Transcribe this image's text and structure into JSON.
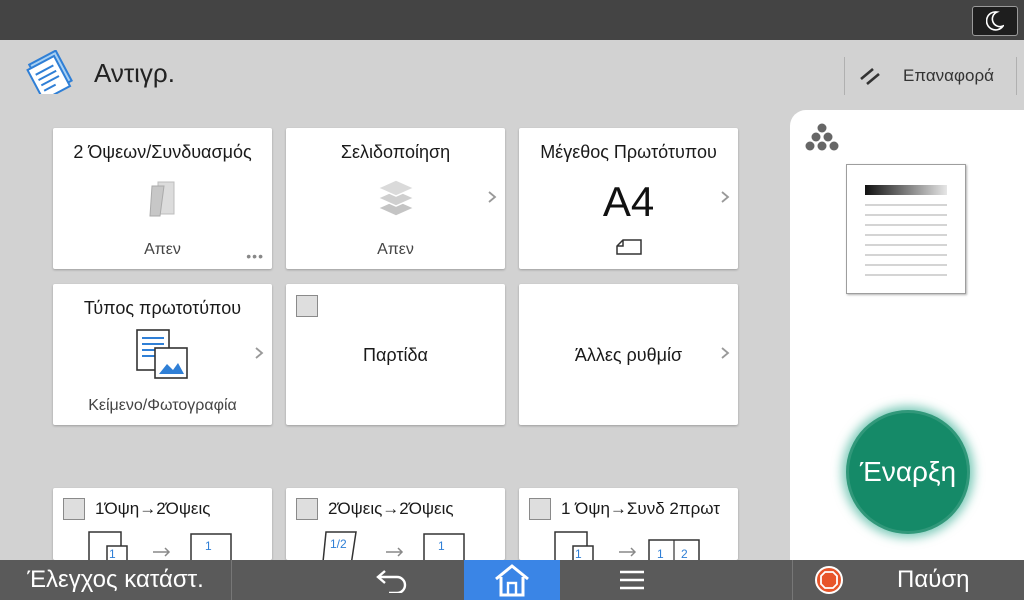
{
  "app": {
    "title": "Αντιγρ.",
    "icon": "copy-document-icon"
  },
  "topbar": {
    "sleep_icon": "moon-icon"
  },
  "reset": {
    "label": "Επαναφορά",
    "icon": "reset-slash-icon"
  },
  "tiles": {
    "duplex": {
      "title": "2 Όψεων/Συνδυασμός",
      "value": "Απεν",
      "icon": "duplex-page-icon"
    },
    "sort": {
      "title": "Σελιδοποίηση",
      "value": "Απεν",
      "icon": "stack-icon"
    },
    "original_size": {
      "title": "Μέγεθος Πρωτότυπου",
      "value": "A4",
      "icon": "paper-orientation-icon"
    },
    "original_type": {
      "title": "Τύπος πρωτοτύπου",
      "value": "Κείμενο/Φωτογραφία",
      "icon": "text-photo-icon"
    },
    "batch": {
      "label": "Παρτίδα"
    },
    "other": {
      "label": "Άλλες ρυθμίσ"
    }
  },
  "presets": [
    {
      "label": "1Όψη→2Όψεις"
    },
    {
      "label": "2Όψεις→2Όψεις"
    },
    {
      "label": "1 Όψη→Συνδ 2πρωτ"
    }
  ],
  "start": {
    "label": "Έναρξη"
  },
  "bottombar": {
    "status_label": "Έλεγχος κατάστ.",
    "stop_label": "Παύση",
    "back_icon": "back-arrow-icon",
    "home_icon": "home-icon",
    "menu_icon": "menu-icon"
  },
  "colors": {
    "accent_blue": "#3a85e6",
    "start_green": "#158a68",
    "stop_orange": "#e8552a",
    "icon_blue": "#2f7fd6"
  }
}
